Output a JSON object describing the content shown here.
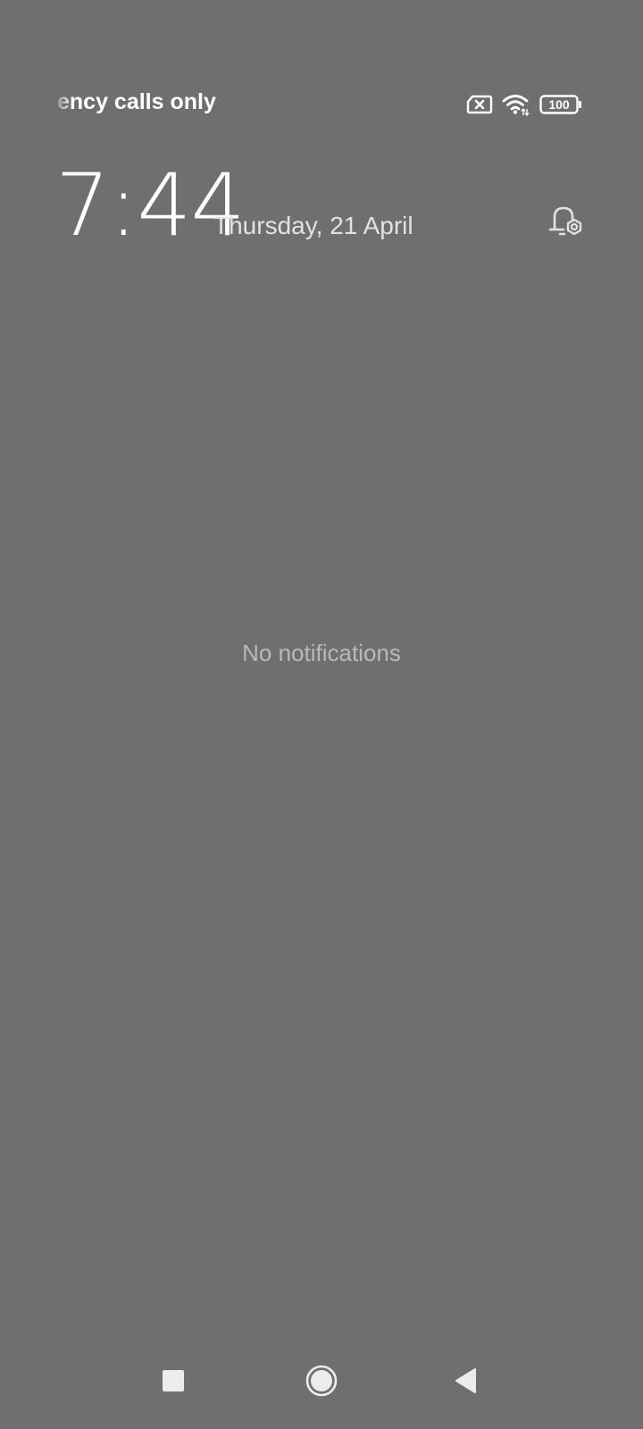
{
  "status_bar": {
    "carrier_text": "ency calls only",
    "icons": [
      "sim-error-icon",
      "wifi-icon",
      "battery-icon"
    ],
    "battery_level": "100"
  },
  "lock_header": {
    "time": "7:44",
    "date": "Thursday, 21 April",
    "settings_icon": "notification-settings-icon"
  },
  "notifications": {
    "empty_text": "No notifications"
  },
  "nav_bar": {
    "buttons": [
      "recents-icon",
      "home-icon",
      "back-icon"
    ]
  },
  "colors": {
    "background": "#6f6f6f",
    "primary_text": "#ffffff",
    "secondary_text": "#b9b9b9"
  }
}
